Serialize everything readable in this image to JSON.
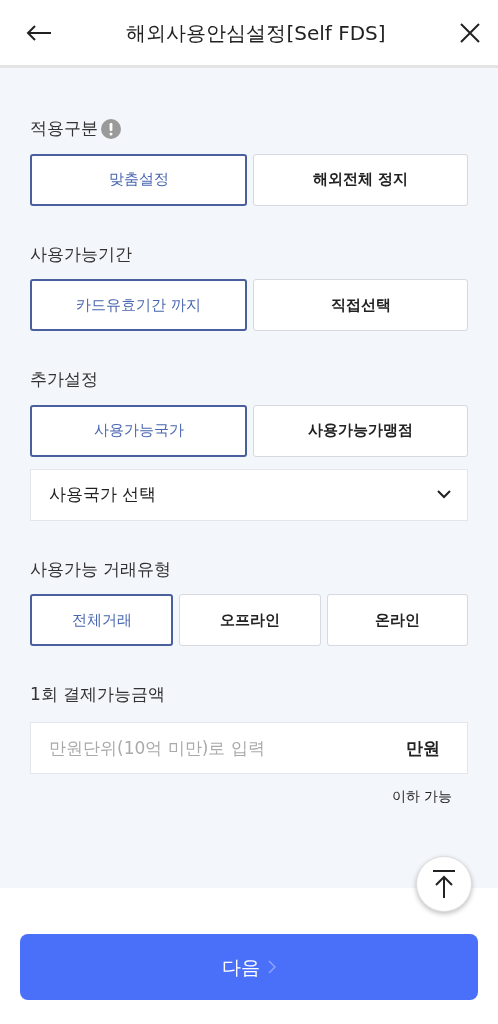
{
  "header": {
    "title": "해외사용안심설정[Self FDS]"
  },
  "sections": [
    {
      "label": "적용구분",
      "info": true,
      "kind": "options",
      "options": [
        {
          "label": "맞춤설정",
          "selected": true
        },
        {
          "label": "해외전체 정지",
          "selected": false
        }
      ]
    },
    {
      "label": "사용가능기간",
      "kind": "options",
      "options": [
        {
          "label": "카드유효기간 까지",
          "selected": true
        },
        {
          "label": "직접선택",
          "selected": false
        }
      ]
    },
    {
      "label": "추가설정",
      "kind": "options",
      "options": [
        {
          "label": "사용가능국가",
          "selected": true
        },
        {
          "label": "사용가능가맹점",
          "selected": false
        }
      ],
      "select": {
        "value": "사용국가 선택"
      }
    },
    {
      "label": "사용가능 거래유형",
      "kind": "options",
      "options": [
        {
          "label": "전체거래",
          "selected": true
        },
        {
          "label": "오프라인",
          "selected": false
        },
        {
          "label": "온라인",
          "selected": false
        }
      ]
    },
    {
      "label": "1회 결제가능금액",
      "kind": "amount",
      "field": {
        "placeholder": "만원단위(10억 미만)로 입력",
        "unit": "만원"
      },
      "note": "이하 가능"
    }
  ],
  "next_button": {
    "label": "다음"
  }
}
